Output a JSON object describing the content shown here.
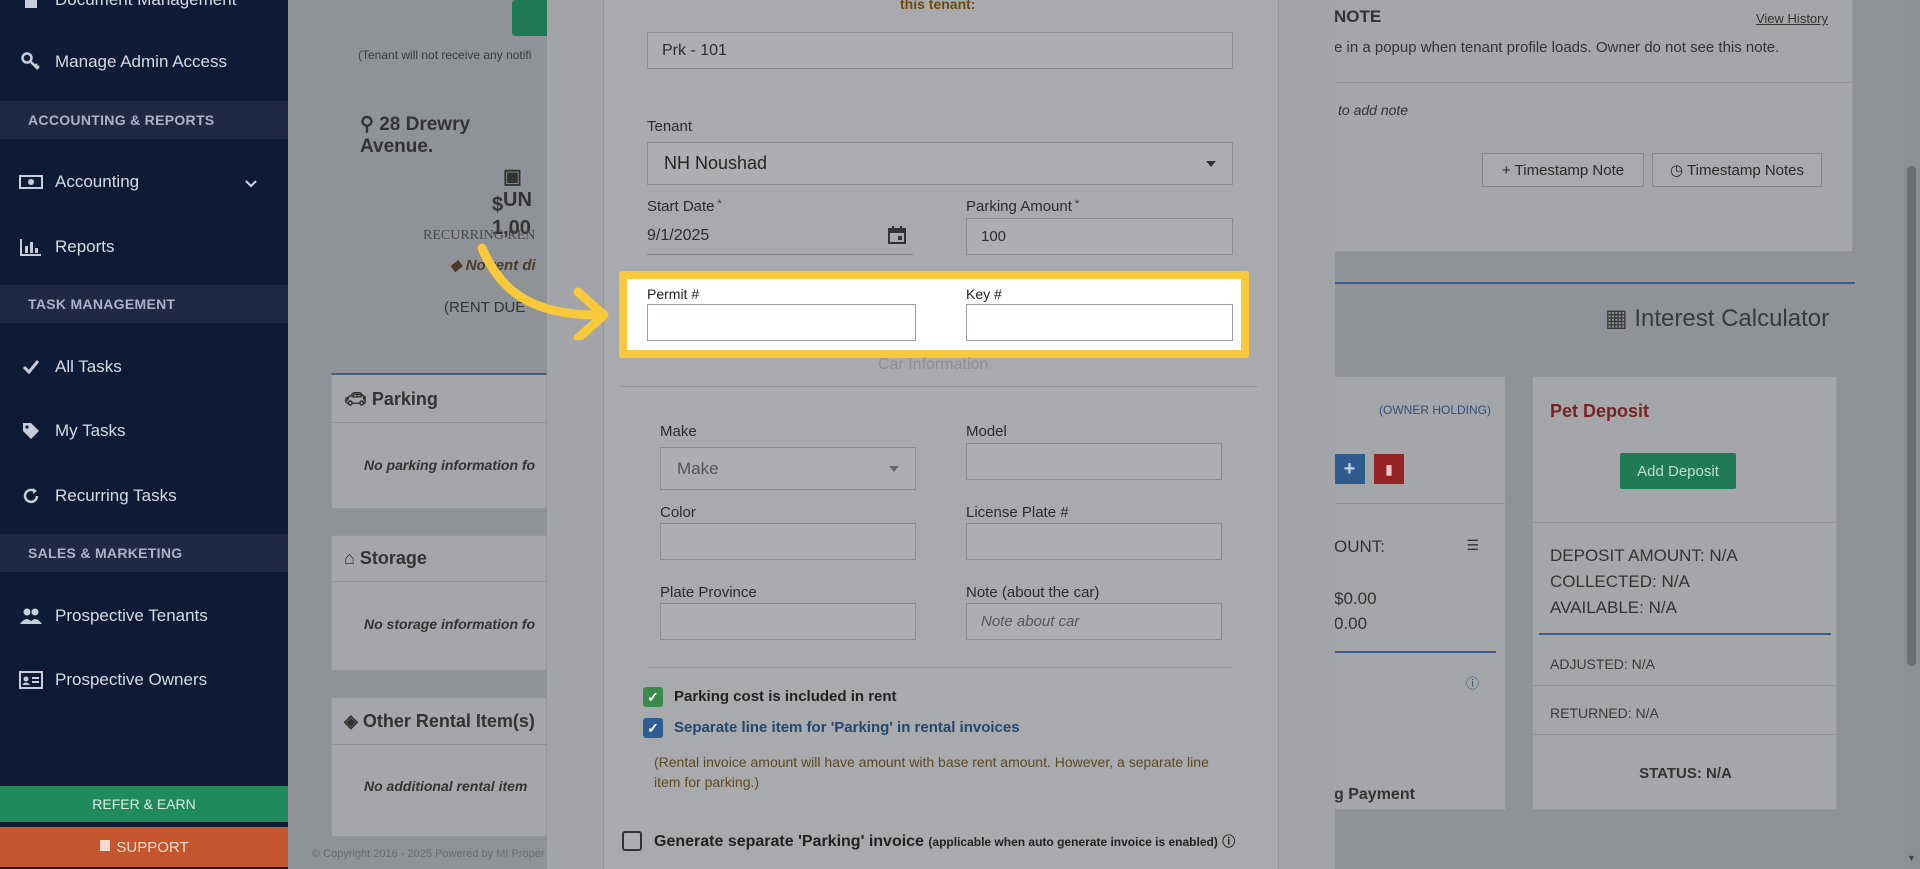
{
  "sidebar": {
    "items": [
      {
        "label": "Document Management",
        "icon": "document-icon"
      },
      {
        "label": "Manage Admin Access",
        "icon": "key-icon"
      },
      {
        "label": "Accounting",
        "icon": "money-icon"
      },
      {
        "label": "Reports",
        "icon": "bar-chart-icon"
      },
      {
        "label": "All Tasks",
        "icon": "check-icon"
      },
      {
        "label": "My Tasks",
        "icon": "tag-icon"
      },
      {
        "label": "Recurring Tasks",
        "icon": "refresh-icon"
      },
      {
        "label": "Prospective Tenants",
        "icon": "users-icon"
      },
      {
        "label": "Prospective Owners",
        "icon": "id-card-icon"
      }
    ],
    "sections": [
      "ACCOUNTING & REPORTS",
      "TASK MANAGEMENT",
      "SALES & MARKETING"
    ],
    "refer_label": "REFER & EARN",
    "support_label": "SUPPORT"
  },
  "background": {
    "notify_note": "(Tenant will not receive any notifi",
    "address": "28 Drewry Avenue.",
    "unit_label": "UN",
    "rent_amount": "$ 1,00",
    "recurring_label": "RECURRING REN",
    "discount_label": "No rent di",
    "rent_due": "(RENT DUE",
    "parking_title": "Parking",
    "parking_empty": "No parking information fo",
    "storage_title": "Storage",
    "storage_empty": "No storage information fo",
    "other_title": "Other Rental Item(s)",
    "other_empty": "No additional rental item",
    "note_title": "NOTE",
    "view_history": "View History",
    "note_desc": "e in a popup when tenant profile loads. Owner do not see this note.",
    "note_add": "to add note",
    "timestamp_note": "Timestamp Note",
    "timestamp_notes": "Timestamp Notes",
    "interest_calc": "Interest Calculator",
    "owner_holding": "(OWNER HOLDING)",
    "amount_label": "OUNT:",
    "amount1": "$0.00",
    "amount2": "0.00",
    "pending_payment": "g Payment",
    "pet_deposit_title": "Pet Deposit",
    "add_deposit": "Add Deposit",
    "deposit_amount": "DEPOSIT AMOUNT: N/A",
    "collected": "COLLECTED: N/A",
    "available": "AVAILABLE: N/A",
    "adjusted": "ADJUSTED: N/A",
    "returned": "RETURNED: N/A",
    "status": "STATUS: N/A",
    "copyright": "© Copyright 2016 - 2025 Powered by MI Proper"
  },
  "modal": {
    "header_text": "this tenant:",
    "parking_spot_value": "Prk - 101",
    "tenant_label": "Tenant",
    "tenant_value": "NH Noushad",
    "start_date_label": "Start Date",
    "start_date_value": "9/1/2025",
    "parking_amount_label": "Parking Amount",
    "parking_amount_value": "100",
    "permit_label": "Permit #",
    "key_label": "Key #",
    "car_info_title": "Car Information",
    "make_label": "Make",
    "make_value": "Make",
    "model_label": "Model",
    "color_label": "Color",
    "license_label": "License Plate #",
    "province_label": "Plate Province",
    "car_note_label": "Note (about the car)",
    "car_note_placeholder": "Note about car",
    "chk1_label": "Parking cost is included in rent",
    "chk2_label": "Separate line item for 'Parking' in rental invoices",
    "chk2_note": "(Rental invoice amount will have amount with base rent amount. However, a separate line item for parking.)",
    "chk3_label": "Generate separate 'Parking' invoice",
    "chk3_note": "(applicable when auto generate invoice is enabled)"
  },
  "colors": {
    "highlight": "#f7c93b",
    "sidebar_bg": "#0e1b34",
    "check_green": "#3a8a4a",
    "check_blue": "#2d5d94"
  }
}
